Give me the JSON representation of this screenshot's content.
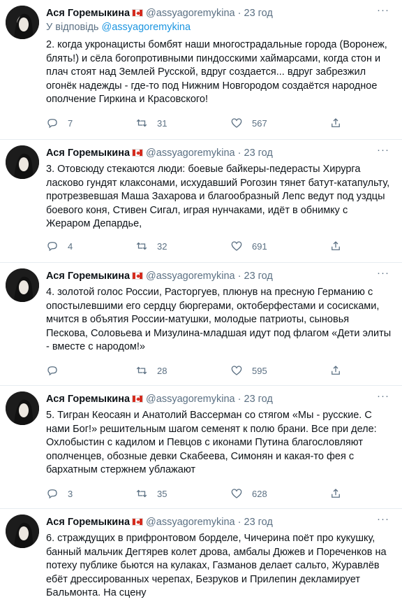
{
  "reply_prefix": "У відповідь",
  "tweets": [
    {
      "name": "Ася Горемыкина",
      "handle": "@assyagoremykina",
      "dot": "·",
      "time": "23 год",
      "reply_to": "@assyagoremykina",
      "text": "2. когда укронацисты бомбят наши многострадальные города (Воронеж, блять!) и сёла богопротивными пиндосскими хаймарсами, когда стон и плач стоят над Землей Русской, вдруг создается... вдруг забрезжил огонёк надежды - где-то под Нижним Новгородом создаётся народное ополчение Гиркина и Красовского!",
      "replies": "7",
      "retweets": "31",
      "likes": "567"
    },
    {
      "name": "Ася Горемыкина",
      "handle": "@assyagoremykina",
      "dot": "·",
      "time": "23 год",
      "text": "3. Отовсюду стекаются люди: боевые байкеры-педерасты Хирурга ласково гундят клаксонами, исхудавший Рогозин тянет батут-катапульту, протрезвевшая Маша Захарова и благообразный Лепс ведут под уздцы боевого коня, Стивен Сигал, играя нунчаками, идёт в обнимку с Жераром Депардье,",
      "replies": "4",
      "retweets": "32",
      "likes": "691"
    },
    {
      "name": "Ася Горемыкина",
      "handle": "@assyagoremykina",
      "dot": "·",
      "time": "23 год",
      "text": "4. золотой голос России, Расторгуев, плюнув на пресную Германию с опостылевшими его сердцу бюргерами, октоберфестами и сосисками, мчится в объятия России-матушки, молодые патриоты, сыновья Пескова, Соловьева и Мизулина-младшая идут под флагом «Дети элиты - вместе с народом!»",
      "replies": "",
      "retweets": "28",
      "likes": "595"
    },
    {
      "name": "Ася Горемыкина",
      "handle": "@assyagoremykina",
      "dot": "·",
      "time": "23 год",
      "text": "5. Тигран Кеосаян и Анатолий Вассерман со стягом «Мы - русские. С нами Бог!» решительным шагом семенят к полю брани. Все при деле: Охлобыстин с кадилом и Певцов с иконами Путина благословляют ополченцев, обозные девки Скабеева, Симонян и какая-то фея с бархатным стержнем ублажают",
      "replies": "3",
      "retweets": "35",
      "likes": "628"
    },
    {
      "name": "Ася Горемыкина",
      "handle": "@assyagoremykina",
      "dot": "·",
      "time": "23 год",
      "text": "6. страждущих в прифронтовом борделе, Чичерина поёт про кукушку, банный мальчик Дегтярев колет дрова, амбалы Дюжев и Пореченков на потеху публике бьются на кулаках, Газманов делает сальто, Журавлёв ебёт дрессированных черепах, Безруков и Прилепин декламирует Бальмонта. На сцену",
      "replies": "",
      "retweets": "",
      "likes": ""
    }
  ],
  "icons": {
    "reply": "reply-icon",
    "retweet": "retweet-icon",
    "like": "heart-icon",
    "share": "share-icon",
    "more": "more-icon",
    "flag": "canada-flag-icon"
  },
  "colors": {
    "text": "#0f1419",
    "secondary": "#5b7083",
    "link": "#1b95e0",
    "divider": "#e6ecf0"
  }
}
